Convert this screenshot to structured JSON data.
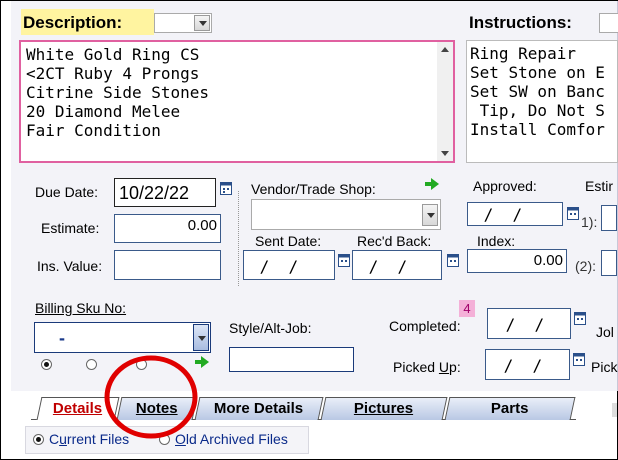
{
  "description": {
    "label": "Description:",
    "lines": [
      "White Gold Ring CS",
      "<2CT Ruby 4 Prongs",
      "Citrine Side Stones",
      "20 Diamond Melee",
      "Fair Condition"
    ]
  },
  "instructions": {
    "label": "Instructions:",
    "lines": [
      "Ring Repair",
      "Set Stone on E",
      "Set SW on Banc",
      " Tip, Do Not S",
      "Install Comfor"
    ]
  },
  "dates": {
    "due_label": "Due Date:",
    "due_value": "10/22/22",
    "estimate_label": "Estimate:",
    "estimate_value": "0.00",
    "ins_label": "Ins. Value:",
    "ins_value": ""
  },
  "vendor": {
    "label": "Vendor/Trade Shop:",
    "value": "",
    "sent_label": "Sent Date:",
    "sent_value": " /  /",
    "recd_label": "Rec'd Back:",
    "recd_value": " /  /"
  },
  "approval": {
    "approved_label": "Approved:",
    "approved_value": " /  /",
    "estim_label": "Estir",
    "index_label": "Index:",
    "index_value": "0.00",
    "hint1": "1):",
    "hint2": "(2):"
  },
  "billing": {
    "label": "Billing Sku No:",
    "value": "-"
  },
  "style_job": {
    "label": "Style/Alt-Job:",
    "value": ""
  },
  "completed": {
    "badge": "4",
    "completed_label": "Completed:",
    "completed_value": " /  /",
    "picked_label": "Picked Up:",
    "picked_value": " /  /",
    "job_label": "Jol",
    "pick_label": "Pick"
  },
  "tabs": [
    "Details",
    "Notes",
    "More Details",
    "Pictures",
    "Parts"
  ],
  "files": {
    "current": "Current Files",
    "archived": "Old Archived Files"
  },
  "colors": {
    "description_highlight": "#fff4a0",
    "description_border": "#e060a0",
    "annotation_circle": "#e00000",
    "active_tab_text": "#c00000"
  }
}
